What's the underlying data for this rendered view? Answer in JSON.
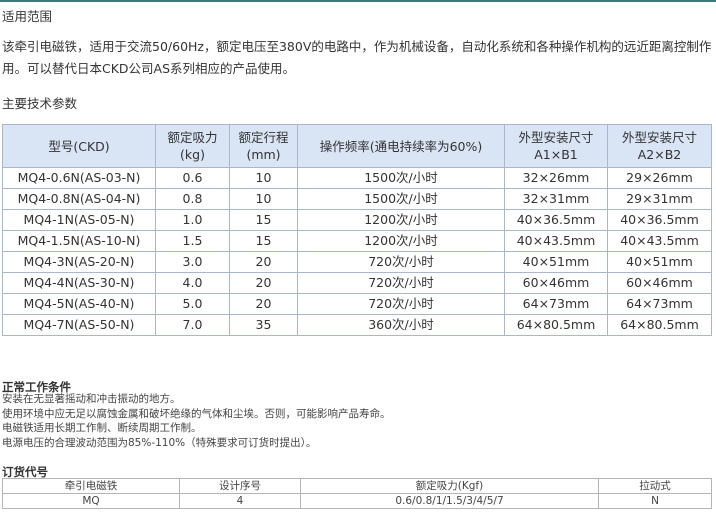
{
  "scope": {
    "heading": "适用范围",
    "intro": "该牵引电磁铁，适用于交流50/60Hz，额定电压至380V的电路中，作为机械设备，自动化系统和各种操作机构的远近距离控制作用。可以替代日本CKD公司AS系列相应的产品使用。"
  },
  "params": {
    "heading": "主要技术参数",
    "headers": [
      {
        "line1": "型号(CKD)",
        "line2": ""
      },
      {
        "line1": "额定吸力",
        "line2": "(kg)"
      },
      {
        "line1": "额定行程",
        "line2": "(mm)"
      },
      {
        "line1": "操作频率(通电持续率为60%)",
        "line2": ""
      },
      {
        "line1": "外型安装尺寸",
        "line2": "A1×B1"
      },
      {
        "line1": "外型安装尺寸",
        "line2": "A2×B2"
      }
    ],
    "rows": [
      [
        "MQ4-0.6N(AS-03-N)",
        "0.6",
        "10",
        "1500次/小时",
        "32×26mm",
        "29×26mm"
      ],
      [
        "MQ4-0.8N(AS-04-N)",
        "0.8",
        "10",
        "1500次/小时",
        "32×31mm",
        "29×31mm"
      ],
      [
        "MQ4-1N(AS-05-N)",
        "1.0",
        "15",
        "1200次/小时",
        "40×36.5mm",
        "40×36.5mm"
      ],
      [
        "MQ4-1.5N(AS-10-N)",
        "1.5",
        "15",
        "1200次/小时",
        "40×43.5mm",
        "40×43.5mm"
      ],
      [
        "MQ4-3N(AS-20-N)",
        "3.0",
        "20",
        "720次/小时",
        "40×51mm",
        "40×51mm"
      ],
      [
        "MQ4-4N(AS-30-N)",
        "4.0",
        "20",
        "720次/小时",
        "60×46mm",
        "60×46mm"
      ],
      [
        "MQ4-5N(AS-40-N)",
        "5.0",
        "20",
        "720次/小时",
        "64×73mm",
        "64×73mm"
      ],
      [
        "MQ4-7N(AS-50-N)",
        "7.0",
        "35",
        "360次/小时",
        "64×80.5mm",
        "64×80.5mm"
      ]
    ]
  },
  "conditions": {
    "heading": "正常工作条件",
    "lines": [
      "安装在无显著摇动和冲击振动的地方。",
      "使用环境中应无足以腐蚀金属和破坏绝缘的气体和尘埃。否则，可能影响产品寿命。",
      "电磁铁适用长期工作制、断续周期工作制。",
      "电源电压的合理波动范围为85%-110%（特殊要求可订货时提出）。"
    ]
  },
  "ordering": {
    "heading": "订货代号",
    "headers": [
      "牵引电磁铁",
      "设计序号",
      "额定吸力(Kgf)",
      "拉动式"
    ],
    "values": [
      "MQ",
      "4",
      "0.6/0.8/1/1.5/3/4/5/7",
      "N"
    ]
  }
}
